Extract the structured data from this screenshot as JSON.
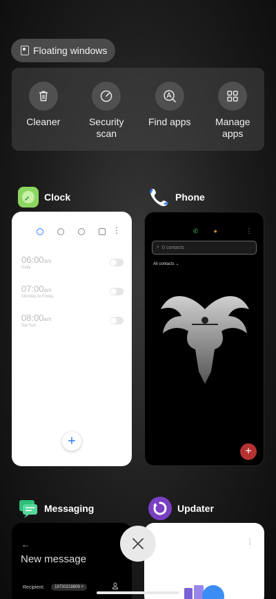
{
  "floating_windows": {
    "label": "Floating windows",
    "icon": "floating-window-icon"
  },
  "quick_actions": [
    {
      "label": "Cleaner",
      "icon": "trash-icon"
    },
    {
      "label": "Security\nscan",
      "icon": "security-scan-icon"
    },
    {
      "label": "Find apps",
      "icon": "find-apps-icon"
    },
    {
      "label": "Manage\napps",
      "icon": "grid-icon"
    }
  ],
  "apps": {
    "clock": {
      "name": "Clock",
      "alarms": [
        {
          "time": "06:00",
          "suffix": "am",
          "days": "Daily"
        },
        {
          "time": "07:00",
          "suffix": "am",
          "days": "Monday to Friday"
        },
        {
          "time": "08:00",
          "suffix": "am",
          "days": "Sat Sun"
        }
      ],
      "fab": "+"
    },
    "phone": {
      "name": "Phone",
      "search_placeholder": "0 contacts",
      "filter": "All contacts",
      "fab": "+"
    },
    "messaging": {
      "name": "Messaging",
      "back": "←",
      "title": "New message",
      "recipient_label": "Recipient:",
      "recipient_chip": "18730218809 ×"
    },
    "updater": {
      "name": "Updater"
    }
  },
  "colors": {
    "accent_blue": "#2a7df6",
    "fab_red": "#b53232",
    "clock_green": "#8bd65f",
    "messaging_green": "#2fbf7a",
    "updater_purple": "#7a3fc2"
  }
}
